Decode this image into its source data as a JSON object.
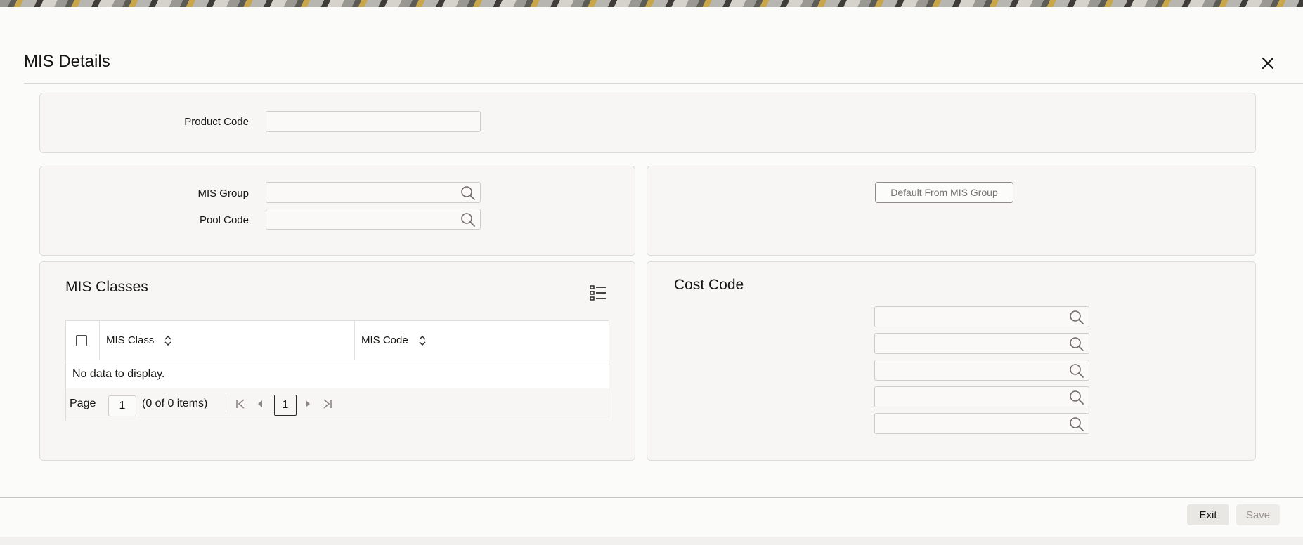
{
  "dialog": {
    "title": "MIS Details"
  },
  "product": {
    "label": "Product Code",
    "value": ""
  },
  "mis_group": {
    "label": "MIS Group",
    "value": ""
  },
  "pool_code": {
    "label": "Pool Code",
    "value": ""
  },
  "default_button": "Default From MIS Group",
  "mis_classes": {
    "title": "MIS Classes",
    "columns": [
      "MIS Class",
      "MIS Code"
    ],
    "rows": [],
    "empty_text": "No data to display.",
    "pager": {
      "page_label": "Page",
      "page_value": "1",
      "items_text": "(0 of 0 items)",
      "current_page": "1"
    }
  },
  "cost_code": {
    "title": "Cost Code",
    "fields": [
      "",
      "",
      "",
      "",
      ""
    ]
  },
  "footer": {
    "exit_label": "Exit",
    "save_label": "Save"
  },
  "colors": {
    "accent": "#161513",
    "disabled_text": "#9a9792",
    "button_bg": "#e9e7e3"
  },
  "icons": [
    "close-icon",
    "search-icon",
    "column-list-icon",
    "sort-icon",
    "first-page-icon",
    "prev-page-icon",
    "next-page-icon",
    "last-page-icon"
  ]
}
